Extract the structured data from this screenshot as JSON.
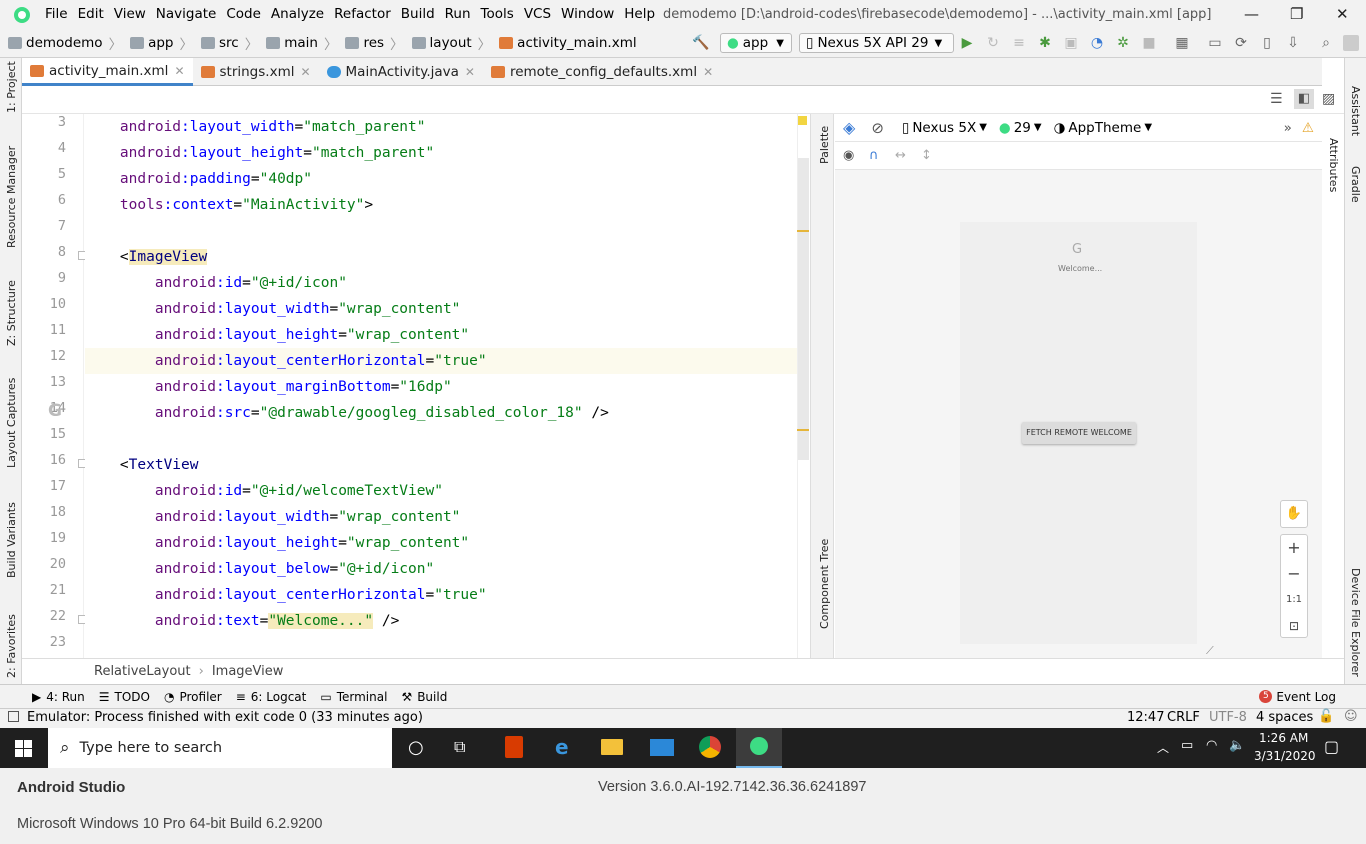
{
  "menu": {
    "items": [
      "File",
      "Edit",
      "View",
      "Navigate",
      "Code",
      "Analyze",
      "Refactor",
      "Build",
      "Run",
      "Tools",
      "VCS",
      "Window",
      "Help"
    ],
    "title": "demodemo [D:\\android-codes\\firebasecode\\demodemo] - ...\\activity_main.xml [app]"
  },
  "nav": {
    "crumbs": [
      "demodemo",
      "app",
      "src",
      "main",
      "res",
      "layout",
      "activity_main.xml"
    ],
    "module": "app",
    "device": "Nexus 5X API 29"
  },
  "tabs": [
    {
      "label": "activity_main.xml",
      "active": true
    },
    {
      "label": "strings.xml"
    },
    {
      "label": "MainActivity.java"
    },
    {
      "label": "remote_config_defaults.xml"
    }
  ],
  "left_tools": [
    "1: Project",
    "Resource Manager",
    "Z: Structure",
    "Layout Captures",
    "Build Variants",
    "2: Favorites"
  ],
  "right_tools": [
    "Assistant",
    "Gradle",
    "Attributes",
    "Device File Explorer"
  ],
  "editor": {
    "line_numbers": [
      "3",
      "4",
      "5",
      "6",
      "7",
      "8",
      "9",
      "10",
      "11",
      "12",
      "13",
      "14",
      "15",
      "16",
      "17",
      "18",
      "19",
      "20",
      "21",
      "22",
      "23"
    ],
    "lines": [
      {
        "indent": "    ",
        "ns": "android",
        "attr": "layout_width",
        "val": "\"match_parent\""
      },
      {
        "indent": "    ",
        "ns": "android",
        "attr": "layout_height",
        "val": "\"match_parent\""
      },
      {
        "indent": "    ",
        "ns": "android",
        "attr": "padding",
        "val": "\"40dp\""
      },
      {
        "indent": "    ",
        "ns": "tools",
        "attr": "context",
        "val": "\"MainActivity\"",
        "tail": ">"
      },
      {
        "indent": "",
        "blank": true
      },
      {
        "indent": "    ",
        "open": "<",
        "tag": "ImageView"
      },
      {
        "indent": "        ",
        "ns": "android",
        "attr": "id",
        "val": "\"@+id/icon\""
      },
      {
        "indent": "        ",
        "ns": "android",
        "attr": "layout_width",
        "val": "\"wrap_content\""
      },
      {
        "indent": "        ",
        "ns": "android",
        "attr": "layout_height",
        "val": "\"wrap_content\""
      },
      {
        "indent": "        ",
        "ns": "android",
        "attr": "layout_centerHorizontal",
        "val": "\"true\"",
        "hl": true
      },
      {
        "indent": "        ",
        "ns": "android",
        "attr": "layout_marginBottom",
        "val": "\"16dp\""
      },
      {
        "indent": "        ",
        "ns": "android",
        "attr": "src",
        "val": "\"@drawable/googleg_disabled_color_18\"",
        "tail": " />"
      },
      {
        "indent": "",
        "blank": true
      },
      {
        "indent": "    ",
        "open": "<",
        "tag": "TextView"
      },
      {
        "indent": "        ",
        "ns": "android",
        "attr": "id",
        "val": "\"@+id/welcomeTextView\""
      },
      {
        "indent": "        ",
        "ns": "android",
        "attr": "layout_width",
        "val": "\"wrap_content\""
      },
      {
        "indent": "        ",
        "ns": "android",
        "attr": "layout_height",
        "val": "\"wrap_content\""
      },
      {
        "indent": "        ",
        "ns": "android",
        "attr": "layout_below",
        "val": "\"@+id/icon\""
      },
      {
        "indent": "        ",
        "ns": "android",
        "attr": "layout_centerHorizontal",
        "val": "\"true\""
      },
      {
        "indent": "        ",
        "ns": "android",
        "attr": "text",
        "val": "\"Welcome...\"",
        "tail": " />"
      },
      {
        "indent": "",
        "blank": true
      }
    ]
  },
  "design": {
    "device": "Nexus 5X",
    "api": "29",
    "theme": "AppTheme",
    "preview_letter": "G",
    "welcome": "Welcome...",
    "button": "FETCH REMOTE WELCOME",
    "zoom_fit": "1:1"
  },
  "palette_label": "Palette",
  "component_tree_label": "Component Tree",
  "breadcrumb": [
    "RelativeLayout",
    "ImageView"
  ],
  "toolwindows": [
    "4: Run",
    "TODO",
    "Profiler",
    "6: Logcat",
    "Terminal",
    "Build"
  ],
  "event_log": "Event Log",
  "event_badge": "5",
  "status": {
    "message": "Emulator: Process finished with exit code 0 (33 minutes ago)",
    "position": "12:47",
    "line_sep": "CRLF",
    "encoding": "UTF-8",
    "indent": "4 spaces"
  },
  "taskbar": {
    "search_placeholder": "Type here to search",
    "time": "1:26 AM",
    "date": "3/31/2020"
  },
  "about": {
    "product": "Android Studio",
    "version": "Version 3.6.0.AI-192.7142.36.36.6241897",
    "os": "Microsoft Windows 10 Pro 64-bit Build 6.2.9200"
  }
}
